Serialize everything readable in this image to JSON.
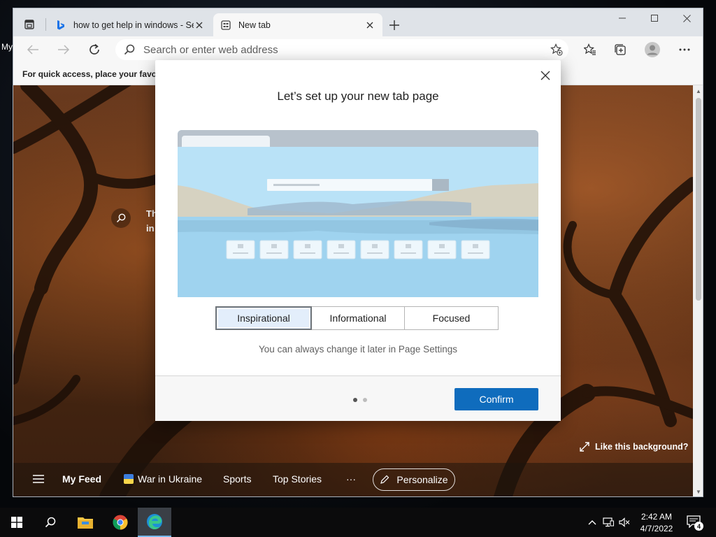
{
  "desktop": {
    "label": "My"
  },
  "browser": {
    "tabs": [
      {
        "title": "how to get help in windows - Se",
        "favicon": "bing-icon"
      },
      {
        "title": "New tab",
        "favicon": "newtab-icon"
      }
    ],
    "omnibox": {
      "placeholder": "Search or enter web address"
    },
    "favorites_bar": {
      "message": "For quick access, place your favorit"
    }
  },
  "ntp": {
    "search_partial": [
      "Th",
      "in"
    ],
    "like_background": "Like this background?",
    "feed": {
      "my_feed": "My Feed",
      "war_in_ukraine": "War in Ukraine",
      "sports": "Sports",
      "top_stories": "Top Stories",
      "more": "···",
      "personalize": "Personalize"
    }
  },
  "modal": {
    "title": "Let’s set up your new tab page",
    "options": [
      "Inspirational",
      "Informational",
      "Focused"
    ],
    "selected_option": "Inspirational",
    "hint": "You can always change it later in Page Settings",
    "confirm": "Confirm",
    "page_dots": {
      "total": 2,
      "current": 1
    }
  },
  "taskbar": {
    "time": "2:42 AM",
    "date": "4/7/2022",
    "notification_count": "4"
  },
  "colors": {
    "accent": "#0f6cbd",
    "selected_option_bg": "#e3eefb"
  }
}
